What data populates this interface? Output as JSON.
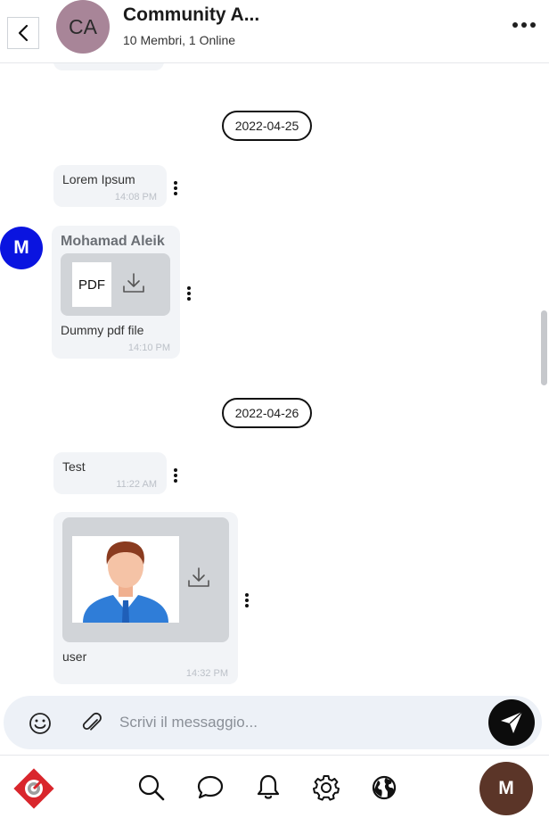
{
  "header": {
    "back_icon": "chevron-left-icon",
    "avatar_initials": "CA",
    "title": "Community A...",
    "subtitle": "10 Membri, 1 Online",
    "menu_icon": "more-horizontal-icon"
  },
  "messages": [
    {
      "type": "date",
      "label": "2022-04-25"
    },
    {
      "type": "text",
      "text": "Lorem Ipsum",
      "time": "14:08 PM"
    },
    {
      "type": "file",
      "sender": "Mohamad Aleik",
      "sender_initial": "M",
      "file_label": "PDF",
      "caption": "Dummy pdf file",
      "time": "14:10 PM"
    },
    {
      "type": "date",
      "label": "2022-04-26"
    },
    {
      "type": "text",
      "text": "Test",
      "time": "11:22 AM"
    },
    {
      "type": "image",
      "caption": "user",
      "time": "14:32 PM"
    }
  ],
  "composer": {
    "placeholder": "Scrivi il messaggio...",
    "emoji_icon": "smiley-icon",
    "attach_icon": "paperclip-icon",
    "send_icon": "send-icon"
  },
  "bottom_nav": {
    "items": [
      "logo-icon",
      "search-icon",
      "chat-icon",
      "bell-icon",
      "gear-icon",
      "globe-icon"
    ],
    "user_initial": "M"
  },
  "colors": {
    "group_avatar": "#a88598",
    "sender_avatar": "#0a14e0",
    "user_avatar": "#5b3528",
    "bubble": "#f2f4f7",
    "composer": "#edf1f7",
    "logo": "#d9262c"
  }
}
